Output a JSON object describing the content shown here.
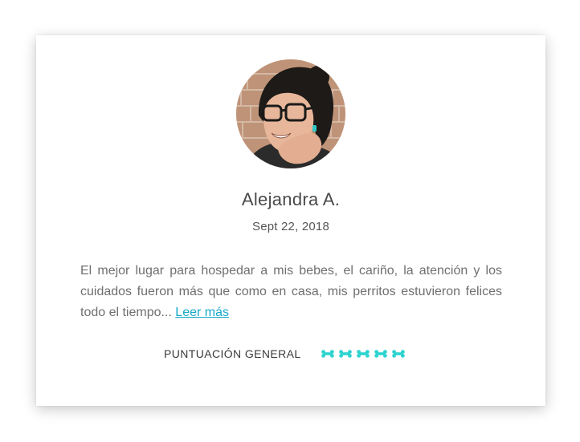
{
  "review_card": {
    "reviewer_name": "Alejandra A.",
    "date": "Sept 22, 2018",
    "review_text": "El mejor lugar para hospedar a mis bebes, el cariño, la atención y los cuidados fueron más que como en casa, mis perritos estuvieron felices todo el tiempo... ",
    "read_more_label": "Leer más",
    "rating_label": "PUNTUACIÓN GENERAL",
    "rating": {
      "value": 5,
      "max": 5,
      "icon": "bone-icon",
      "color": "#2fd3cf"
    },
    "link_color": "#17a9c9"
  }
}
